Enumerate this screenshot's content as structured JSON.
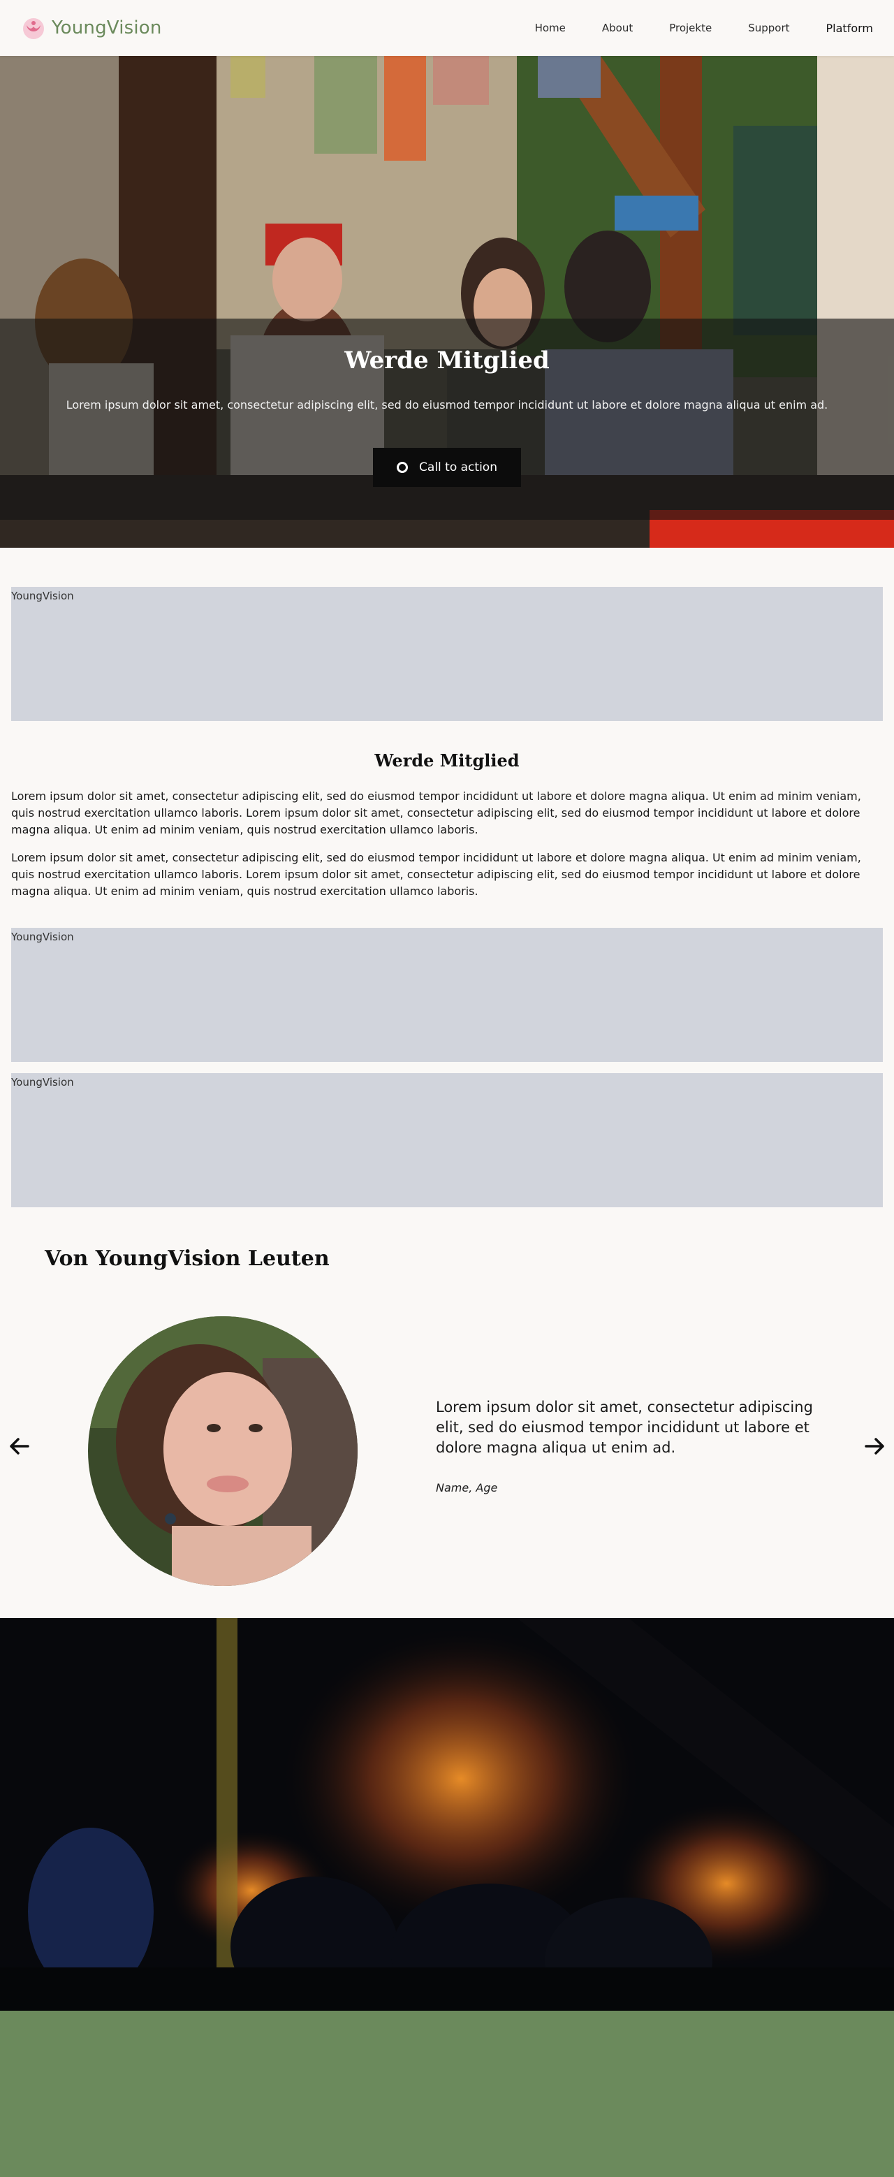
{
  "nav": {
    "brand": "YoungVision",
    "links": [
      "Home",
      "About",
      "Projekte",
      "Support"
    ],
    "platform": "Platform"
  },
  "hero": {
    "title": "Werde Mitglied",
    "text": "Lorem ipsum dolor sit amet, consectetur adipiscing elit, sed do eiusmod tempor incididunt ut labore et dolore magna aliqua ut enim ad.",
    "cta_label": "Call to action"
  },
  "blocks": {
    "label1": "YoungVision",
    "label2": "YoungVision",
    "label3": "YoungVision"
  },
  "section": {
    "title": "Werde Mitglied",
    "para1": "Lorem ipsum dolor sit amet, consectetur adipiscing elit, sed do eiusmod tempor incididunt ut labore et dolore magna aliqua. Ut enim ad minim veniam, quis nostrud exercitation ullamco laboris. Lorem ipsum dolor sit amet, consectetur adipiscing elit, sed do eiusmod tempor incididunt ut labore et dolore magna aliqua. Ut enim ad minim veniam, quis nostrud exercitation ullamco laboris.",
    "para2": "Lorem ipsum dolor sit amet, consectetur adipiscing elit, sed do eiusmod tempor incididunt ut labore et dolore magna aliqua. Ut enim ad minim veniam, quis nostrud exercitation ullamco laboris. Lorem ipsum dolor sit amet, consectetur adipiscing elit, sed do eiusmod tempor incididunt ut labore et dolore magna aliqua. Ut enim ad minim veniam, quis nostrud exercitation ullamco laboris."
  },
  "testimonials": {
    "title": "Von YoungVision Leuten",
    "quote": "Lorem ipsum dolor sit amet, consectetur adipiscing elit, sed do eiusmod tempor incididunt ut labore et dolore magna aliqua ut enim ad.",
    "author": "Name, Age",
    "prev_icon": "arrow-left-icon",
    "next_icon": "arrow-right-icon"
  },
  "colors": {
    "brand": "#6b8a5c",
    "logo": "#e06a8c",
    "placeholder": "#d1d4dc",
    "background": "#faf8f6"
  }
}
